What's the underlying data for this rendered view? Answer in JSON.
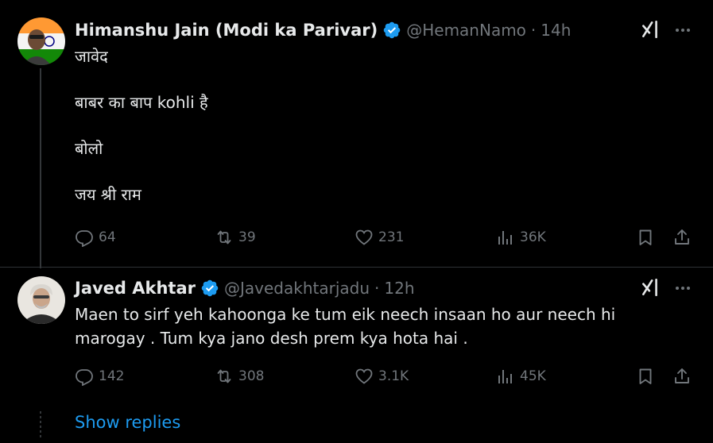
{
  "posts": [
    {
      "name": "Himanshu Jain (Modi ka Parivar)",
      "handle": "@HemanNamo",
      "separator": "·",
      "time": "14h",
      "paragraphs": [
        "जावेद",
        "बाबर का बाप kohli है",
        "बोलो",
        "जय श्री राम"
      ],
      "replies": "64",
      "reposts": "39",
      "likes": "231",
      "views": "36K"
    },
    {
      "name": "Javed Akhtar",
      "handle": "@Javedakhtarjadu",
      "separator": "·",
      "time": "12h",
      "paragraphs": [
        "Maen to sirf yeh kahoonga ke tum eik neech insaan ho aur neech hi marogay . Tum kya jano desh prem kya hota hai ."
      ],
      "replies": "142",
      "reposts": "308",
      "likes": "3.1K",
      "views": "45K"
    }
  ],
  "show_replies": "Show replies",
  "colors": {
    "background": "#000000",
    "text": "#e7e9ea",
    "muted": "#71767b",
    "accent": "#1d9bf0",
    "thread_line": "#333639"
  },
  "icons": {
    "verified": "verified-badge-icon",
    "grok": "grok-icon",
    "more": "more-icon",
    "reply": "reply-icon",
    "repost": "repost-icon",
    "like": "like-icon",
    "views": "views-icon",
    "bookmark": "bookmark-icon",
    "share": "share-icon"
  }
}
